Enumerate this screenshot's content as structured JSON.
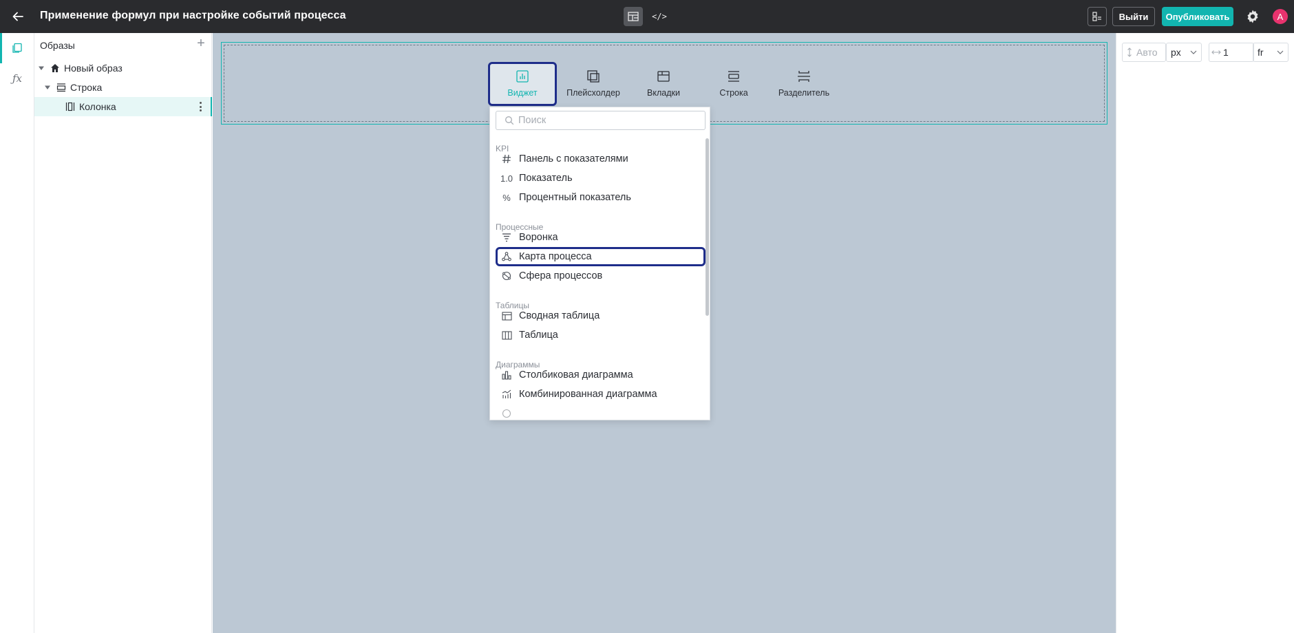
{
  "header": {
    "back_icon": "arrow-left-icon",
    "title": "Применение формул при настройке событий процесса",
    "mode_design_icon": "layout-icon",
    "mode_code_label": "</>",
    "exit_label": "Выйти",
    "publish_label": "Опубликовать",
    "avatar_letter": "A"
  },
  "rail": {
    "items": [
      "pages-icon",
      "formula-icon"
    ],
    "formula_label": "ƒx"
  },
  "tree": {
    "title": "Образы",
    "add_label": "+",
    "nodes": [
      {
        "label": "Новый образ",
        "icon": "home-icon"
      },
      {
        "label": "Строка",
        "icon": "row-icon"
      },
      {
        "label": "Колонка",
        "icon": "column-icon"
      }
    ]
  },
  "palette": {
    "items": [
      {
        "label": "Виджет",
        "icon": "widget-icon"
      },
      {
        "label": "Плейсхолдер",
        "icon": "placeholder-icon"
      },
      {
        "label": "Вкладки",
        "icon": "tabs-icon"
      },
      {
        "label": "Строка",
        "icon": "row-icon"
      },
      {
        "label": "Разделитель",
        "icon": "divider-icon"
      }
    ]
  },
  "dropdown": {
    "search_placeholder": "Поиск",
    "groups": [
      {
        "label": "KPI",
        "items": [
          {
            "label": "Панель с показателями",
            "icon": "hash-icon"
          },
          {
            "label": "Показатель",
            "icon_text": "1.0"
          },
          {
            "label": "Процентный показатель",
            "icon_text": "%"
          }
        ]
      },
      {
        "label": "Процессные",
        "items": [
          {
            "label": "Воронка",
            "icon": "funnel-icon"
          },
          {
            "label": "Карта процесса",
            "icon": "process-map-icon"
          },
          {
            "label": "Сфера процессов",
            "icon": "sphere-icon"
          }
        ]
      },
      {
        "label": "Таблицы",
        "items": [
          {
            "label": "Сводная таблица",
            "icon": "pivot-table-icon"
          },
          {
            "label": "Таблица",
            "icon": "table-icon"
          }
        ]
      },
      {
        "label": "Диаграммы",
        "items": [
          {
            "label": "Столбиковая диаграмма",
            "icon": "bar-chart-icon"
          },
          {
            "label": "Комбинированная диаграмма",
            "icon": "combo-chart-icon"
          }
        ]
      }
    ]
  },
  "props": {
    "height_placeholder": "Авто",
    "height_unit": "px",
    "width_value": "1",
    "width_unit": "fr"
  }
}
